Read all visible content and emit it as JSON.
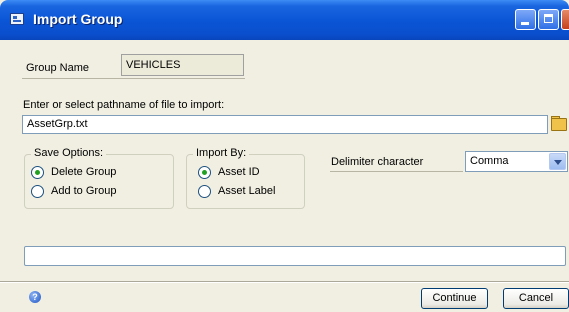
{
  "window": {
    "title": "Import Group",
    "app_icon": "window-app-icon",
    "controls": [
      "minimize",
      "maximize",
      "close"
    ]
  },
  "group_name": {
    "label": "Group Name",
    "value": "VEHICLES"
  },
  "path": {
    "label": "Enter or select pathname of file to import:",
    "value": "AssetGrp.txt",
    "browse_icon": "folder-icon"
  },
  "save_options": {
    "legend": "Save Options:",
    "options": [
      "Delete Group",
      "Add to Group"
    ],
    "selected": "Delete Group"
  },
  "import_by": {
    "legend": "Import By:",
    "options": [
      "Asset ID",
      "Asset Label"
    ],
    "selected": "Asset ID"
  },
  "delimiter": {
    "label": "Delimiter character",
    "value": "Comma"
  },
  "status": {
    "value": ""
  },
  "footer": {
    "help_icon": "help-icon",
    "continue_label": "Continue",
    "cancel_label": "Cancel"
  }
}
